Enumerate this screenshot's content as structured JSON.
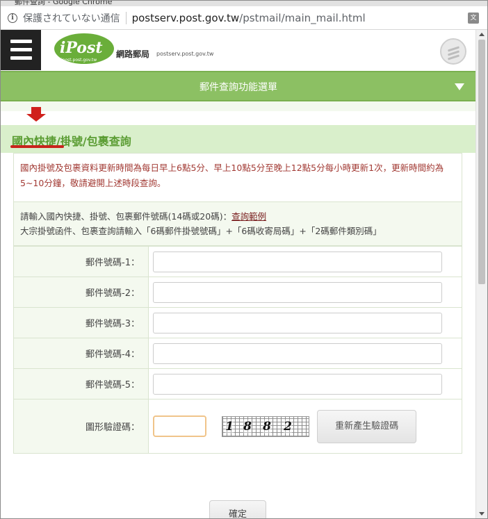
{
  "browser": {
    "window_title": "郵件查詢 - Google Chrome",
    "security_text": "保護されていない通信",
    "url_domain": "postserv.post.gov.tw",
    "url_path": "/pstmail/main_mail.html"
  },
  "header": {
    "logo_text": "iPost",
    "logo_subtext": "ipost.post.gov.tw",
    "site_name": "網路郵局",
    "site_domain": "postserv.post.gov.tw"
  },
  "nav": {
    "menu_label": "郵件查詢功能選單"
  },
  "section": {
    "title": "國內快捷/掛號/包裹查詢"
  },
  "notice": {
    "text": "國內掛號及包裹資料更新時間為每日早上6點5分、早上10點5分至晚上12點5分每小時更新1次，更新時間約為5~10分鐘，敬請避開上述時段查詢。"
  },
  "instructions": {
    "line1": "請輸入國內快捷、掛號、包裹郵件號碼(14碼或20碼)：",
    "example_link": "查詢範例",
    "line2": "大宗掛號函件、包裹查詢請輸入「6碼郵件掛號號碼」+「6碼收寄局碼」+「2碼郵件類別碼」"
  },
  "form": {
    "fields": [
      {
        "label": "郵件號碼-1：",
        "value": ""
      },
      {
        "label": "郵件號碼-2：",
        "value": ""
      },
      {
        "label": "郵件號碼-3：",
        "value": ""
      },
      {
        "label": "郵件號碼-4：",
        "value": ""
      },
      {
        "label": "郵件號碼-5：",
        "value": ""
      }
    ],
    "captcha_label": "圖形驗證碼：",
    "captcha_value": "",
    "captcha_digits": [
      "1",
      "8",
      "8",
      "2"
    ],
    "regenerate_label": "重新產生驗證碼",
    "submit_label": "確定"
  },
  "colors": {
    "nav_green": "#8cc063",
    "section_bg": "#d9efcb",
    "title_green": "#5a9c32",
    "notice_red": "#a23a34",
    "annotation_red": "#d0211c"
  }
}
